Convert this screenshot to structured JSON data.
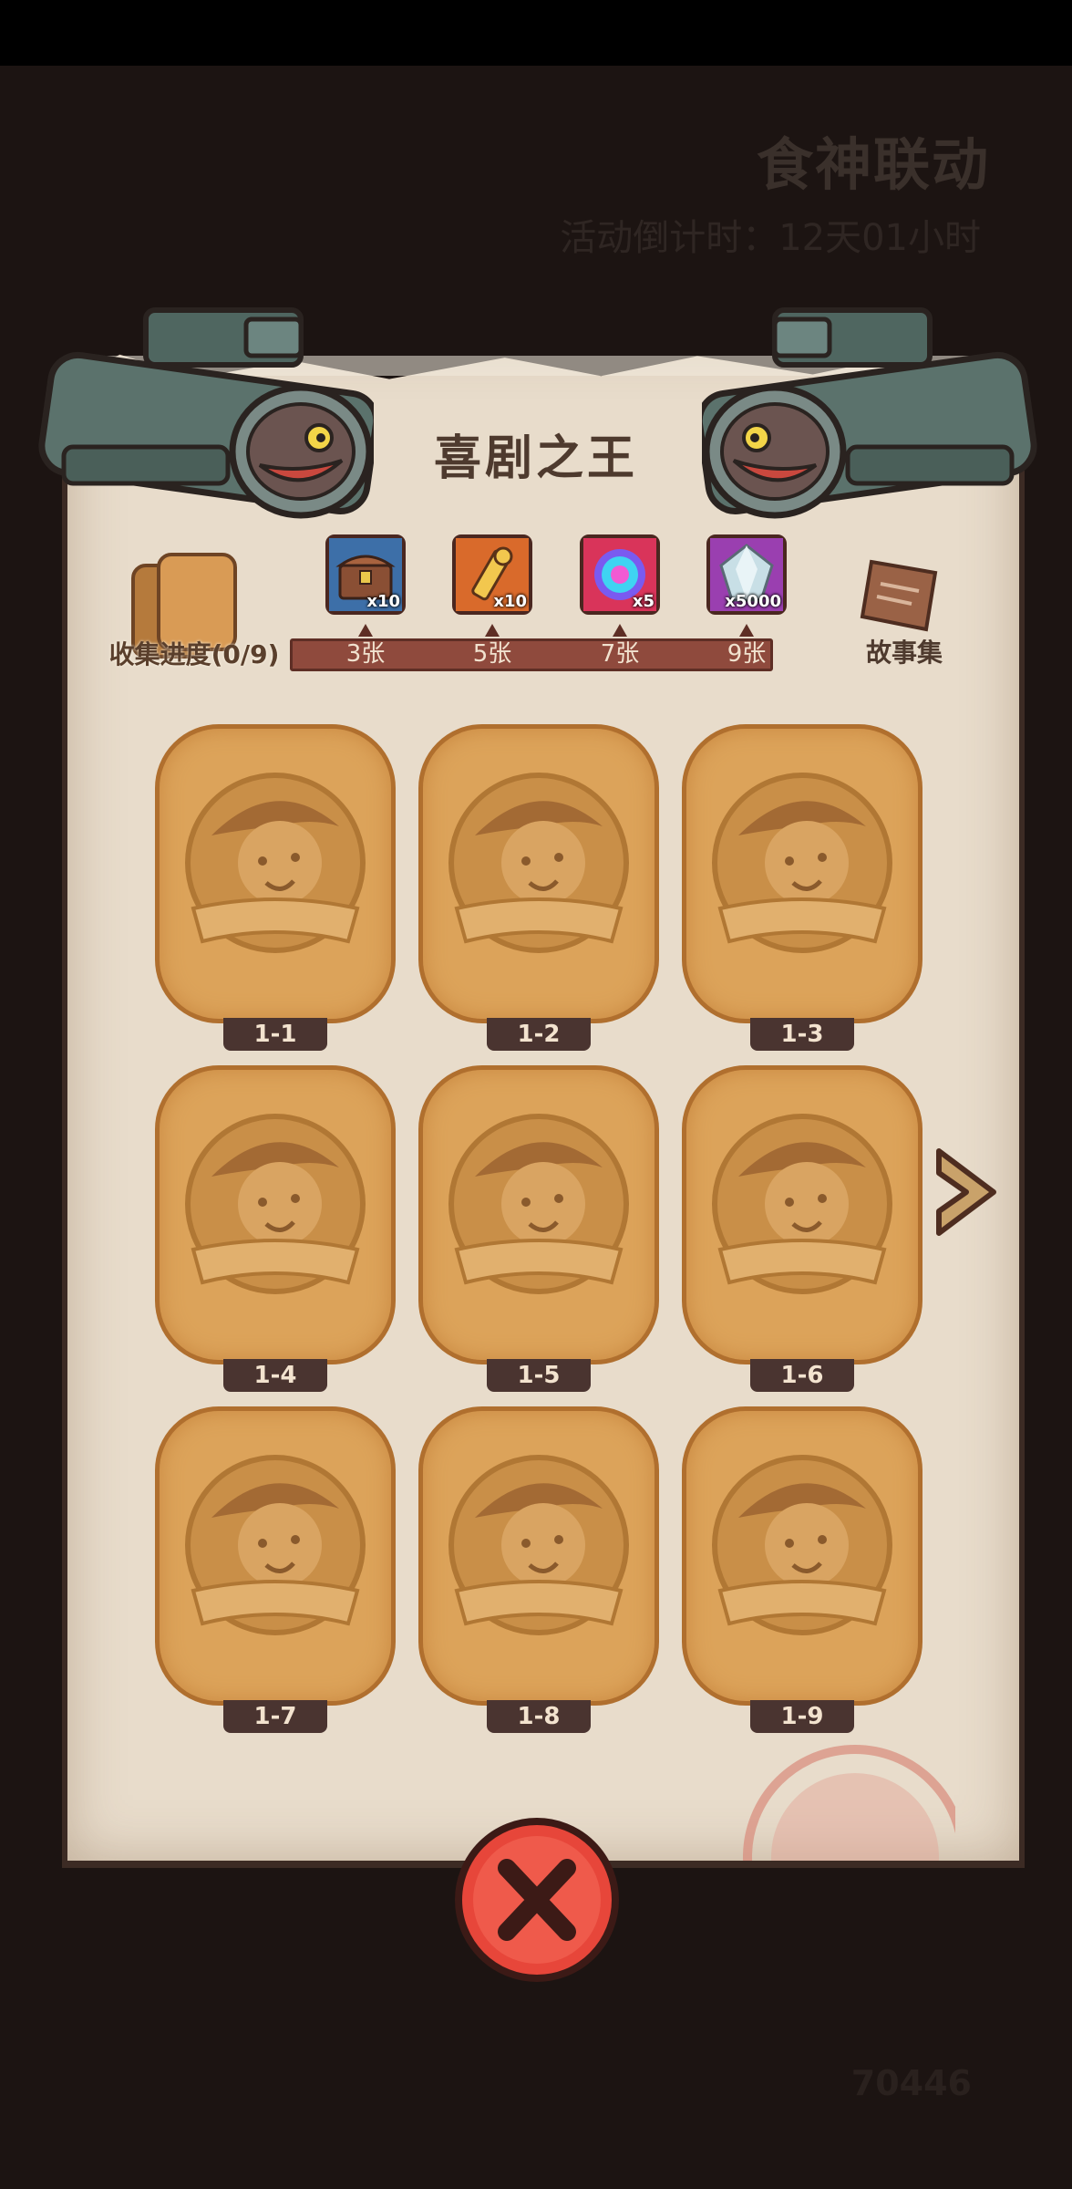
{
  "background": {
    "event_title": "食神联动",
    "event_timer": "活动倒计时：12天01小时",
    "currency_value": "70446"
  },
  "panel": {
    "title": "喜剧之王",
    "progress_label": "收集进度(0/9)",
    "story_label": "故事集"
  },
  "rewards": [
    {
      "icon": "treasure-chest-icon",
      "quantity": "x10",
      "tier": "3张",
      "color": "#3d6fa8"
    },
    {
      "icon": "golden-key-icon",
      "quantity": "x10",
      "tier": "5张",
      "color": "#d96a2b"
    },
    {
      "icon": "magic-orb-icon",
      "quantity": "x5",
      "tier": "7张",
      "color": "#d9345a"
    },
    {
      "icon": "crystal-gem-icon",
      "quantity": "x5000",
      "tier": "9张",
      "color": "#9a3fb0"
    }
  ],
  "cards": [
    {
      "label": "1-1"
    },
    {
      "label": "1-2"
    },
    {
      "label": "1-3"
    },
    {
      "label": "1-4"
    },
    {
      "label": "1-5"
    },
    {
      "label": "1-6"
    },
    {
      "label": "1-7"
    },
    {
      "label": "1-8"
    },
    {
      "label": "1-9"
    }
  ],
  "colors": {
    "parchment": "#e8dccb",
    "card": "#dca35a",
    "close_button": "#e7463a"
  }
}
